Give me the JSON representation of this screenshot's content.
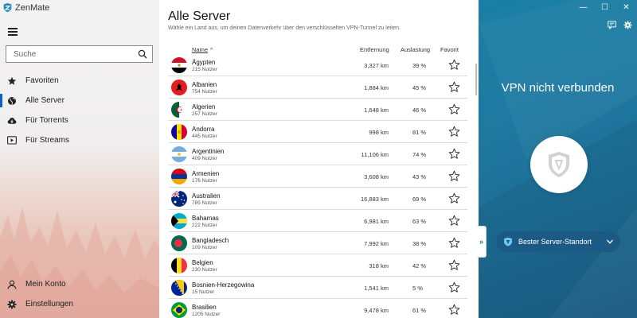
{
  "app": {
    "name": "ZenMate"
  },
  "sidebar": {
    "search_placeholder": "Suche",
    "items": [
      {
        "label": "Favoriten",
        "icon": "star-icon"
      },
      {
        "label": "Alle Server",
        "icon": "globe-icon",
        "active": true
      },
      {
        "label": "Für Torrents",
        "icon": "cloud-download-icon"
      },
      {
        "label": "Für Streams",
        "icon": "play-icon"
      }
    ],
    "bottom_items": [
      {
        "label": "Mein Konto",
        "icon": "user-icon"
      },
      {
        "label": "Einstellungen",
        "icon": "gear-icon"
      }
    ]
  },
  "main": {
    "title": "Alle Server",
    "subtitle": "Wähle ein Land aus, um deinen Datenverkehr über den verschlüsselten VPN-Tunnel zu leiten.",
    "columns": {
      "name": "Name",
      "distance": "Entfernung",
      "load": "Auslastung",
      "favorite": "Favorit"
    },
    "servers": [
      {
        "country": "Ägypten",
        "users": "215 Nutzer",
        "distance": "3,327 km",
        "load": "39 %",
        "flag": "egypt"
      },
      {
        "country": "Albanien",
        "users": "754 Nutzer",
        "distance": "1,884 km",
        "load": "45 %",
        "flag": "albania"
      },
      {
        "country": "Algerien",
        "users": "257 Nutzer",
        "distance": "1,648 km",
        "load": "46 %",
        "flag": "algeria"
      },
      {
        "country": "Andorra",
        "users": "445 Nutzer",
        "distance": "998 km",
        "load": "81 %",
        "flag": "andorra"
      },
      {
        "country": "Argentinien",
        "users": "409 Nutzer",
        "distance": "11,106 km",
        "load": "74 %",
        "flag": "argentina"
      },
      {
        "country": "Armenien",
        "users": "176 Nutzer",
        "distance": "3,608 km",
        "load": "43 %",
        "flag": "armenia"
      },
      {
        "country": "Australien",
        "users": "785 Nutzer",
        "distance": "16,883 km",
        "load": "69 %",
        "flag": "australia"
      },
      {
        "country": "Bahamas",
        "users": "222 Nutzer",
        "distance": "6,981 km",
        "load": "63 %",
        "flag": "bahamas"
      },
      {
        "country": "Bangladesch",
        "users": "109 Nutzer",
        "distance": "7,992 km",
        "load": "38 %",
        "flag": "bangladesh"
      },
      {
        "country": "Belgien",
        "users": "230 Nutzer",
        "distance": "318 km",
        "load": "42 %",
        "flag": "belgium"
      },
      {
        "country": "Bosnien-Herzegowina",
        "users": "15 Nutzer",
        "distance": "1,541 km",
        "load": "5 %",
        "flag": "bosnia"
      },
      {
        "country": "Brasilien",
        "users": "1205 Nutzer",
        "distance": "9,478 km",
        "load": "61 %",
        "flag": "brazil"
      }
    ]
  },
  "vpn": {
    "status": "VPN nicht verbunden",
    "location_label": "Bester Server-Standort"
  },
  "colors": {
    "accent": "#0a63c9",
    "panel": "#1d6f98"
  }
}
